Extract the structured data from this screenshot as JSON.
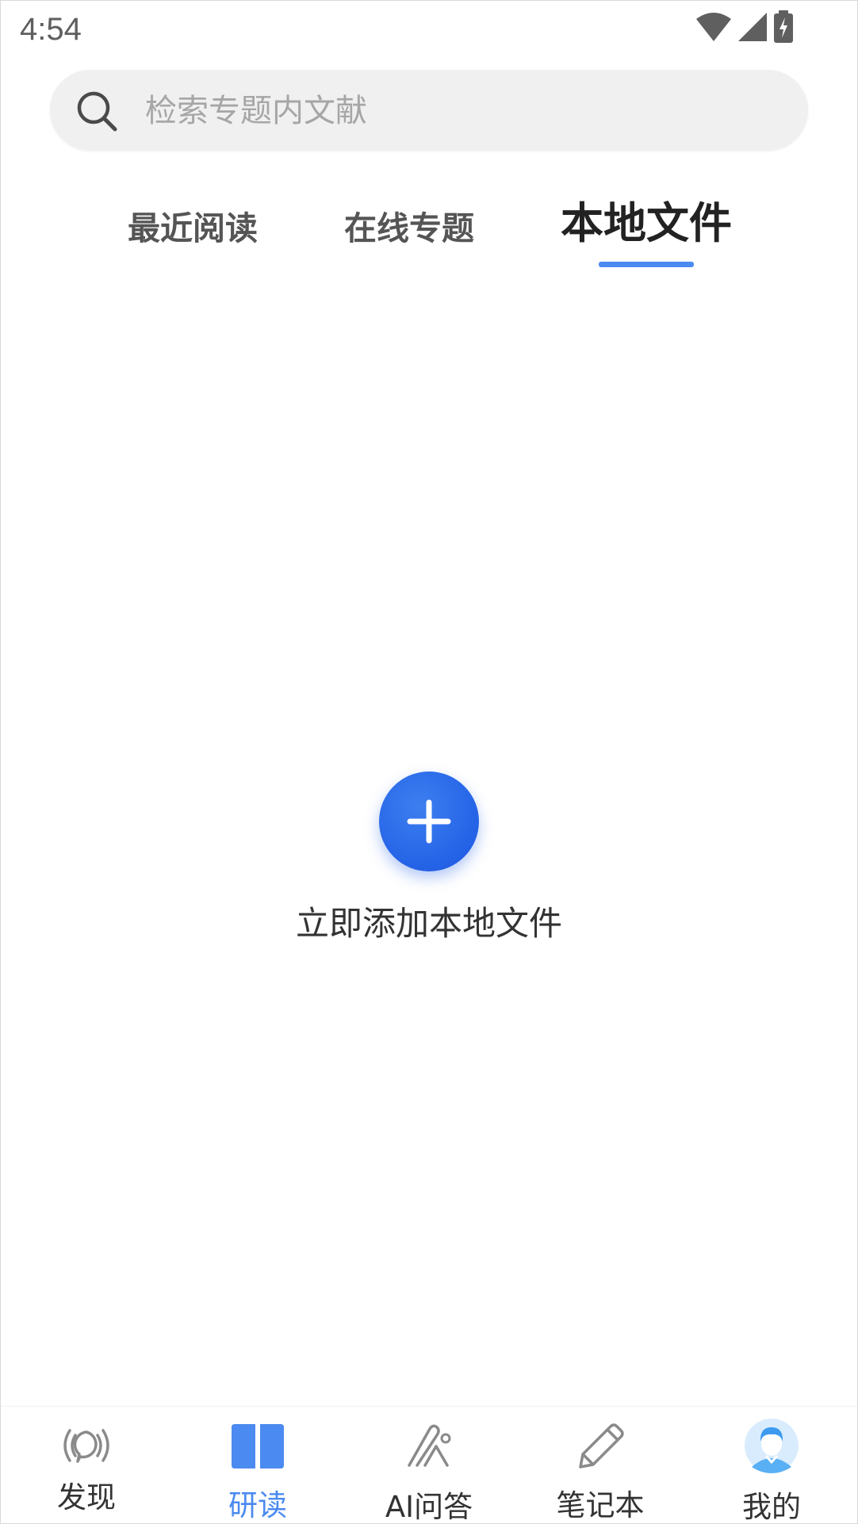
{
  "status_bar": {
    "time": "4:54",
    "icons": [
      "wifi-icon",
      "cell-signal-icon",
      "battery-charging-icon"
    ]
  },
  "search": {
    "placeholder": "检索专题内文献",
    "value": ""
  },
  "tabs": [
    {
      "label": "最近阅读",
      "active": false
    },
    {
      "label": "在线专题",
      "active": false
    },
    {
      "label": "本地文件",
      "active": true
    }
  ],
  "empty_state": {
    "button_icon": "plus-icon",
    "caption": "立即添加本地文件"
  },
  "bottom_nav": [
    {
      "label": "发现",
      "icon": "broadcast-icon",
      "active": false
    },
    {
      "label": "研读",
      "icon": "book-icon",
      "active": true
    },
    {
      "label": "AI问答",
      "icon": "ai-pen-icon",
      "active": false
    },
    {
      "label": "笔记本",
      "icon": "pencil-icon",
      "active": false
    },
    {
      "label": "我的",
      "icon": "avatar-icon",
      "active": false
    }
  ],
  "colors": {
    "accent": "#4b8af0",
    "fab": "#2462e6",
    "search_bg": "#f0f0f0",
    "text_primary": "#222222",
    "text_secondary": "#555555"
  }
}
